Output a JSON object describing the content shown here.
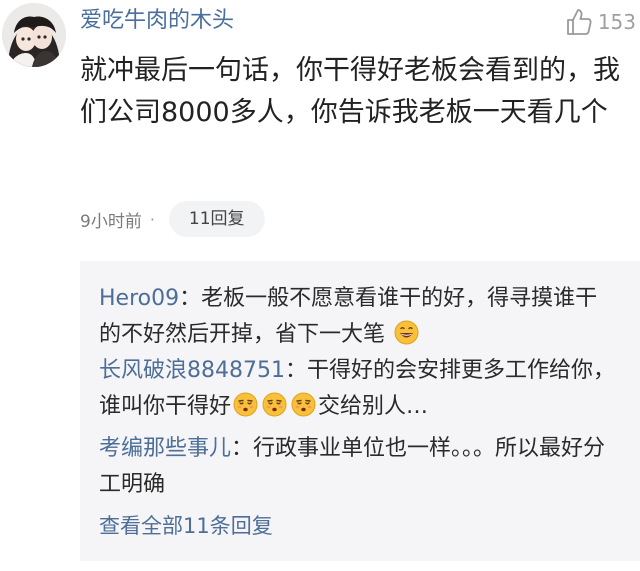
{
  "comment": {
    "username": "爱吃牛肉的木头",
    "like_count": "153",
    "text": "就冲最后一句话，你干得好老板会看到的，我们公司8000多人，你告诉我老板一天看几个",
    "time": "9小时前",
    "separator": "·",
    "reply_count_label": "11回复"
  },
  "replies": [
    {
      "author": "Hero09",
      "colon": "：",
      "text_before": "老板一般不愿意看谁干的好，得寻摸谁干的不好然后开掉，省下一大笔",
      "emoji": "grin-emoji",
      "text_after": ""
    },
    {
      "author": "长风破浪8848751",
      "colon": "：",
      "text_before": "干得好的会安排更多工作给你，谁叫你干得好",
      "emoji": "smirk-emoji",
      "text_after": "交给别人…"
    },
    {
      "author": "考编那些事儿",
      "colon": "：",
      "text_before": "行政事业单位也一样。。。所以最好分工明确",
      "emoji": "",
      "text_after": ""
    }
  ],
  "view_all_label": "查看全部11条回复",
  "colors": {
    "username": "#4a6f9c",
    "reply_author": "#4d6e97",
    "reply_box_bg": "#f5f5f7",
    "pill_bg": "#f2f3f5"
  }
}
